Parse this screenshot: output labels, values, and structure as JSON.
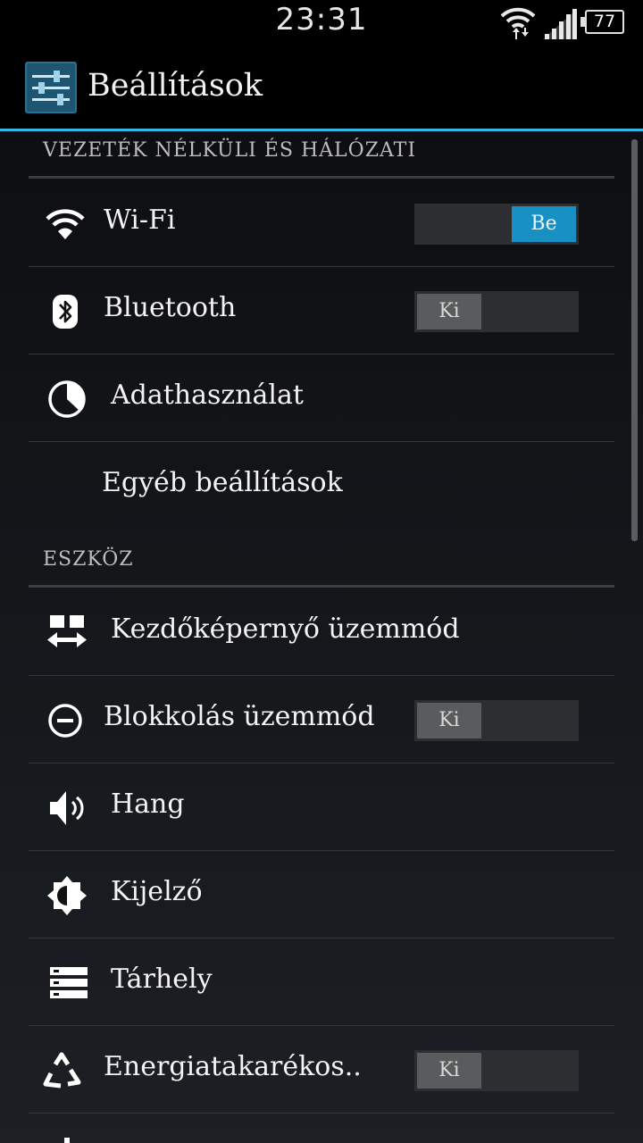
{
  "status_bar": {
    "time": "23:31",
    "battery": "77",
    "icons": [
      "wifi-data-icon",
      "signal-icon",
      "battery-icon"
    ]
  },
  "action_bar": {
    "title": "Beállítások",
    "icon": "settings-sliders-icon"
  },
  "sections": [
    {
      "header": "VEZETÉK NÉLKÜLI ÉS HÁLÓZATI",
      "items": [
        {
          "label": "Wi-Fi",
          "icon": "wifi-icon",
          "toggle": "Be",
          "toggle_state": "on"
        },
        {
          "label": "Bluetooth",
          "icon": "bluetooth-icon",
          "toggle": "Ki",
          "toggle_state": "off"
        },
        {
          "label": "Adathasználat",
          "icon": "data-usage-icon"
        },
        {
          "label": "Egyéb beállítások"
        }
      ]
    },
    {
      "header": "ESZKÖZ",
      "items": [
        {
          "label": "Kezdőképernyő üzemmód",
          "icon": "home-screen-mode-icon"
        },
        {
          "label": "Blokkolás üzemmód",
          "icon": "blocking-mode-icon",
          "toggle": "Ki",
          "toggle_state": "off"
        },
        {
          "label": "Hang",
          "icon": "sound-icon"
        },
        {
          "label": "Kijelző",
          "icon": "display-brightness-icon"
        },
        {
          "label": "Tárhely",
          "icon": "storage-icon"
        },
        {
          "label": "Energiatakarékos..",
          "icon": "power-saving-icon",
          "toggle": "Ki",
          "toggle_state": "off"
        }
      ]
    }
  ],
  "colors": {
    "accent": "#33b5e5",
    "toggle_on": "#1990c4",
    "toggle_off": "#5a5b5d",
    "background": "#121418"
  }
}
